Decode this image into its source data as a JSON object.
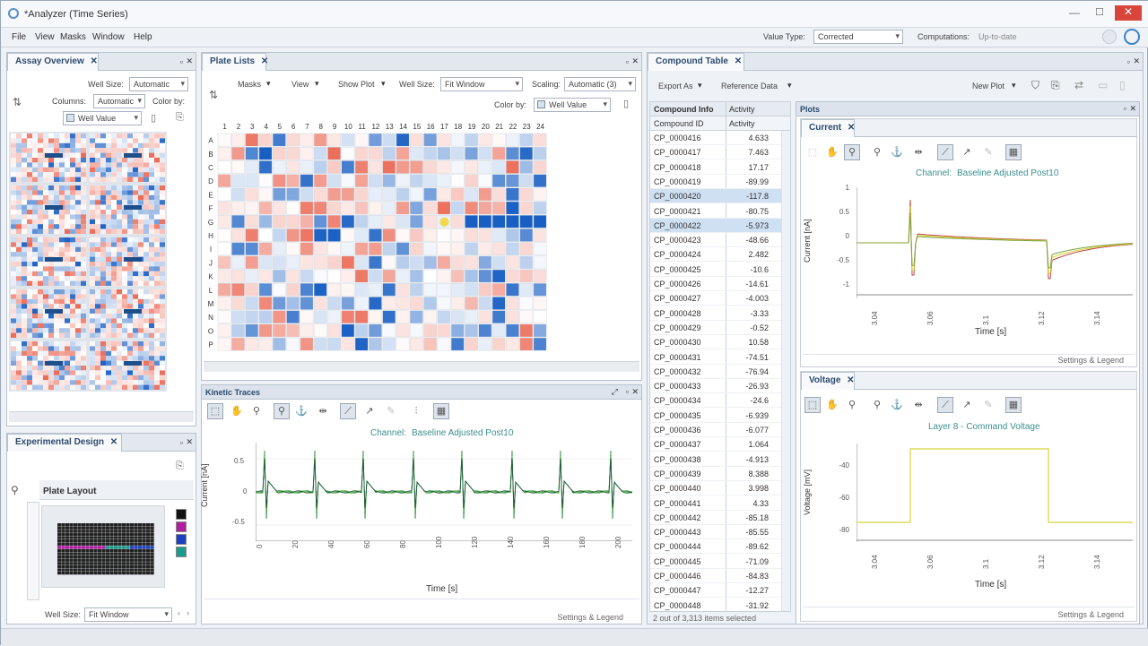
{
  "app": {
    "title": "*Analyzer (Time Series)"
  },
  "menu": [
    "File",
    "View",
    "Masks",
    "Window",
    "Help"
  ],
  "header": {
    "value_type_label": "Value Type:",
    "value_type_value": "Corrected",
    "computations_label": "Computations:",
    "computations_value": "Up-to-date"
  },
  "assay_overview": {
    "tab": "Assay Overview",
    "well_size_label": "Well Size:",
    "well_size_value": "Automatic",
    "columns_label": "Columns:",
    "columns_value": "Automatic",
    "color_by_label": "Color by:",
    "color_by_value": "Well Value"
  },
  "experimental_design": {
    "tab": "Experimental Design",
    "plate_layout_title": "Plate Layout",
    "well_size_label": "Well Size:",
    "well_size_value": "Fit Window",
    "legend_colors": [
      "#111111",
      "#b01fa0",
      "#1e3fbf",
      "#1c9a8c"
    ]
  },
  "plate_map": {
    "tab": "Plate Lists",
    "toolbar": [
      "Masks",
      "View",
      "Show Plot",
      "Well Size:"
    ],
    "well_size_value": "Fit Window",
    "scaling_label": "Scaling:",
    "scaling_value": "Automatic (3)",
    "color_by_label": "Color by:",
    "color_by_value": "Well Value",
    "columns": [
      "1",
      "2",
      "3",
      "4",
      "5",
      "6",
      "7",
      "8",
      "9",
      "10",
      "11",
      "12",
      "13",
      "14",
      "15",
      "16",
      "17",
      "18",
      "19",
      "20",
      "21",
      "22",
      "23",
      "24"
    ],
    "rows": [
      "A",
      "B",
      "C",
      "D",
      "E",
      "F",
      "G",
      "H",
      "I",
      "J",
      "K",
      "L",
      "M",
      "N",
      "O",
      "P"
    ]
  },
  "kinetic_traces": {
    "tab": "Kinetic Traces",
    "channel_label": "Channel:",
    "channel_value": "Baseline Adjusted Post10",
    "ylabel": "Current [nA]",
    "xlabel": "Time [s]",
    "yticks": [
      "0.5",
      "0",
      "-0.5"
    ],
    "xticks": [
      "0",
      "20",
      "40",
      "60",
      "80",
      "100",
      "120",
      "140",
      "160",
      "180",
      "200"
    ],
    "footer": "Settings & Legend"
  },
  "compound_table": {
    "tab": "Compound Table",
    "export_label": "Export As",
    "reference_label": "Reference Data",
    "new_plot_label": "New Plot",
    "group_label": "Compound Info",
    "group_label2": "Activity",
    "col_id": "Compound ID",
    "col_activity": "Activity",
    "rows": [
      {
        "id": "CP_0000416",
        "activity": "4.633"
      },
      {
        "id": "CP_0000417",
        "activity": "7.463"
      },
      {
        "id": "CP_0000418",
        "activity": "17.17"
      },
      {
        "id": "CP_0000419",
        "activity": "-89.99"
      },
      {
        "id": "CP_0000420",
        "activity": "-117.8"
      },
      {
        "id": "CP_0000421",
        "activity": "-80.75"
      },
      {
        "id": "CP_0000422",
        "activity": "-5.973"
      },
      {
        "id": "CP_0000423",
        "activity": "-48.66"
      },
      {
        "id": "CP_0000424",
        "activity": "2.482"
      },
      {
        "id": "CP_0000425",
        "activity": "-10.6"
      },
      {
        "id": "CP_0000426",
        "activity": "-14.61"
      },
      {
        "id": "CP_0000427",
        "activity": "-4.003"
      },
      {
        "id": "CP_0000428",
        "activity": "-3.33"
      },
      {
        "id": "CP_0000429",
        "activity": "-0.52"
      },
      {
        "id": "CP_0000430",
        "activity": "10.58"
      },
      {
        "id": "CP_0000431",
        "activity": "-74.51"
      },
      {
        "id": "CP_0000432",
        "activity": "-76.94"
      },
      {
        "id": "CP_0000433",
        "activity": "-26.93"
      },
      {
        "id": "CP_0000434",
        "activity": "-24.6"
      },
      {
        "id": "CP_0000435",
        "activity": "-6.939"
      },
      {
        "id": "CP_0000436",
        "activity": "-6.077"
      },
      {
        "id": "CP_0000437",
        "activity": "1.064"
      },
      {
        "id": "CP_0000438",
        "activity": "-4.913"
      },
      {
        "id": "CP_0000439",
        "activity": "8.388"
      },
      {
        "id": "CP_0000440",
        "activity": "3.998"
      },
      {
        "id": "CP_0000441",
        "activity": "4.33"
      },
      {
        "id": "CP_0000442",
        "activity": "-85.18"
      },
      {
        "id": "CP_0000443",
        "activity": "-85.55"
      },
      {
        "id": "CP_0000444",
        "activity": "-89.62"
      },
      {
        "id": "CP_0000445",
        "activity": "-71.09"
      },
      {
        "id": "CP_0000446",
        "activity": "-84.83"
      },
      {
        "id": "CP_0000447",
        "activity": "-12.27"
      },
      {
        "id": "CP_0000448",
        "activity": "-31.92"
      }
    ],
    "status": "2 out of 3,313 items selected"
  },
  "plots": {
    "tab": "Plots",
    "current": {
      "tab": "Current",
      "channel_label": "Channel:",
      "channel_value": "Baseline Adjusted Post10",
      "ylabel": "Current [nA]",
      "xlabel": "Time [s]",
      "yticks": [
        "1",
        "0.5",
        "0",
        "-0.5",
        "-1"
      ],
      "xticks": [
        "3.04",
        "3.06",
        "3.1",
        "3.12",
        "3.14"
      ],
      "footer": "Settings & Legend"
    },
    "voltage": {
      "tab": "Voltage",
      "title": "Layer 8 - Command Voltage",
      "ylabel": "Voltage [mV]",
      "xlabel": "Time [s]",
      "yticks": [
        "-40",
        "-60",
        "-80"
      ],
      "xticks": [
        "3.04",
        "3.06",
        "3.1",
        "3.12",
        "3.14"
      ],
      "footer": "Settings & Legend"
    }
  }
}
